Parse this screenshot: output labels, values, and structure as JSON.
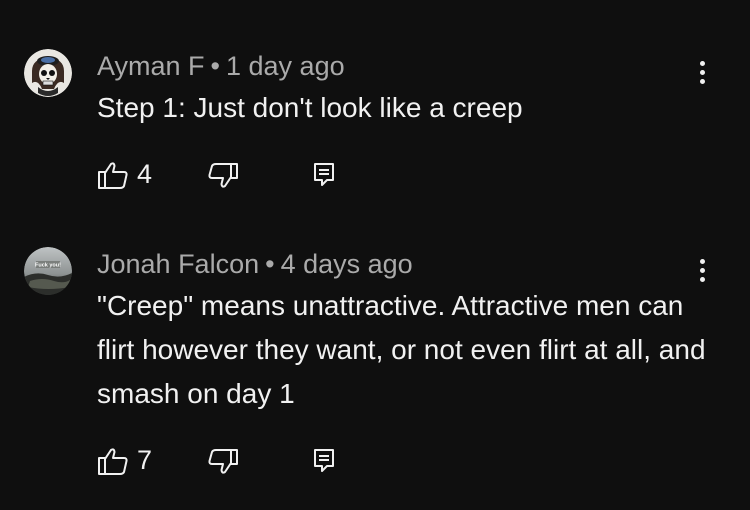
{
  "comments": [
    {
      "author": "Ayman F",
      "separator": "•",
      "time": "1 day ago",
      "text": "Step 1: Just don't look like a creep",
      "likes": "4"
    },
    {
      "author": "Jonah Falcon",
      "separator": "•",
      "time": "4 days ago",
      "text": "\"Creep\" means unattractive. Attractive men can flirt however they want, or not even flirt at all, and smash on day 1",
      "likes": "7",
      "avatar_text": "Fuck you!"
    }
  ],
  "colors": {
    "background": "#0f0f0f",
    "meta_text": "#aaaaaa",
    "primary_text": "#f1f1f1"
  },
  "icons": {
    "like": "thumb-up-icon",
    "dislike": "thumb-down-icon",
    "reply": "reply-icon",
    "menu": "more-vert-icon"
  }
}
